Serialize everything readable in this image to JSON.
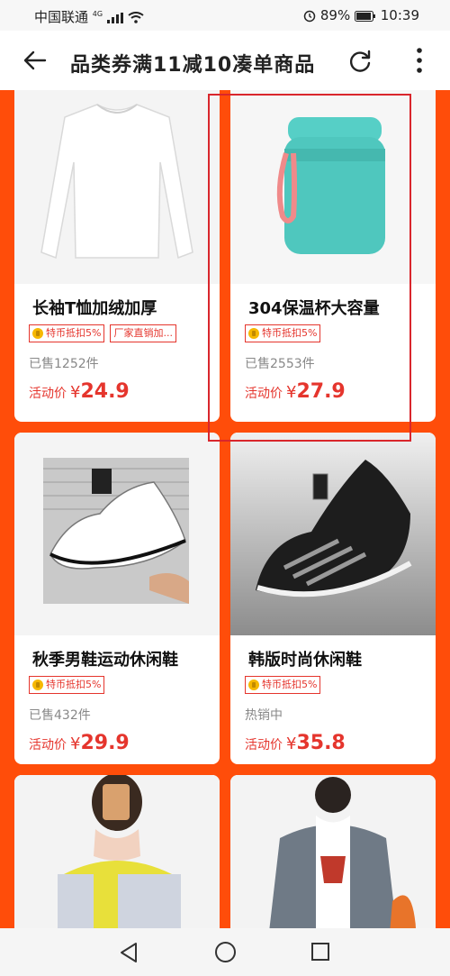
{
  "status": {
    "carrier": "中国联通",
    "net": "4G",
    "battery": "89%",
    "time": "10:39"
  },
  "header": {
    "title": "品类券满11减10凑单商品"
  },
  "products": [
    {
      "name": "长袖T恤加绒加厚",
      "tags": [
        "特币抵扣5%",
        "厂家直销加..."
      ],
      "sold": "已售1252件",
      "price_label": "活动价",
      "currency": "¥",
      "price": "24.9"
    },
    {
      "name": "304保温杯大容量",
      "tags": [
        "特币抵扣5%"
      ],
      "sold": "已售2553件",
      "price_label": "活动价",
      "currency": "¥",
      "price": "27.9"
    },
    {
      "name": "秋季男鞋运动休闲鞋",
      "tags": [
        "特币抵扣5%"
      ],
      "sold": "已售432件",
      "price_label": "活动价",
      "currency": "¥",
      "price": "29.9"
    },
    {
      "name": "韩版时尚休闲鞋",
      "tags": [
        "特币抵扣5%"
      ],
      "sold": "热销中",
      "price_label": "活动价",
      "currency": "¥",
      "price": "35.8"
    }
  ],
  "colors": {
    "accent": "#e5352d",
    "background": "#ff4d0a"
  },
  "icons": {
    "back": "back-arrow-icon",
    "refresh": "refresh-icon",
    "more": "more-vertical-icon"
  }
}
